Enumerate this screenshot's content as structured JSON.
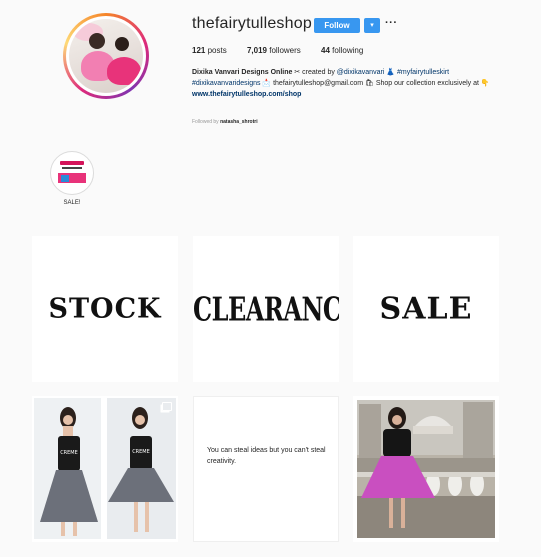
{
  "profile": {
    "username": "thefairytulleshop",
    "follow_label": "Follow",
    "dropdown_label": "▾",
    "more_label": "···",
    "stats": {
      "posts_count": "121",
      "posts_label": "posts",
      "followers_count": "7,019",
      "followers_label": "followers",
      "following_count": "44",
      "following_label": "following"
    },
    "bio": {
      "name": "Dixika Vanvari Designs Online",
      "line1_rest": " ✂ created by ",
      "mention": "@dixikavanvari",
      "line1_emoji": " 👗 ",
      "hashtag1": "#myfairytulleskirt",
      "hashtag2": "#dixikavanvaridesigns",
      "line2_rest": " 📩 thefairytulleshop@gmail.com 🛍 Shop our collection exclusively at 👇",
      "website": "www.thefairytulleshop.com/shop"
    },
    "followed_by_prefix": "Followed by ",
    "followed_by_user": "natasha_shrotri"
  },
  "highlights": [
    {
      "label": "SALE!"
    }
  ],
  "posts": {
    "stock_text": "STOCK",
    "clearance_text": "CLEARANCE",
    "sale_text": "SALE",
    "quote_text": "You can steal ideas but you can't steal creativity."
  },
  "colors": {
    "accent": "#3897f0",
    "background": "#fafafa",
    "skirt_pink": "#c94fc0",
    "skirt_gray": "#6f7480"
  }
}
